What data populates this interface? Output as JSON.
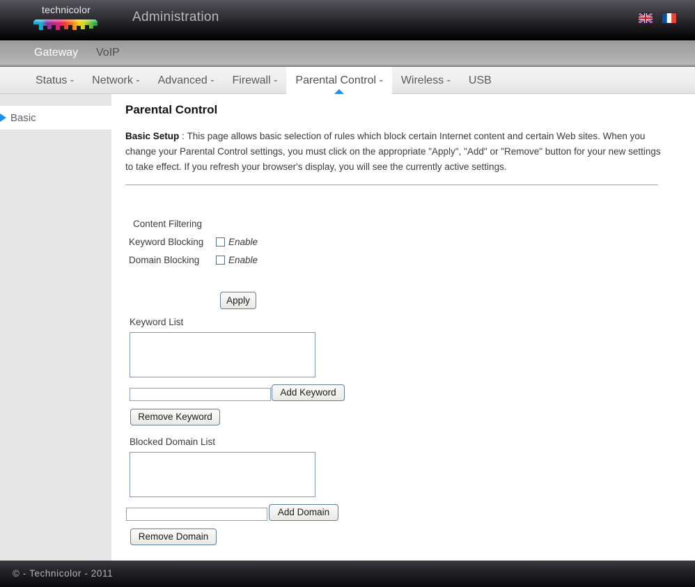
{
  "header": {
    "logo_text": "technicolor",
    "title": "Administration",
    "flags": [
      {
        "name": "flag-uk",
        "label": "English"
      },
      {
        "name": "flag-fr",
        "label": "Français"
      }
    ]
  },
  "gateway_bar": {
    "items": [
      {
        "label": "Gateway",
        "active": true
      },
      {
        "label": "VoIP",
        "active": false
      }
    ]
  },
  "nav": {
    "items": [
      {
        "label": "Status -",
        "active": false
      },
      {
        "label": "Network -",
        "active": false
      },
      {
        "label": "Advanced -",
        "active": false
      },
      {
        "label": "Firewall -",
        "active": false
      },
      {
        "label": "Parental Control -",
        "active": true
      },
      {
        "label": "Wireless -",
        "active": false
      },
      {
        "label": "USB",
        "active": false
      }
    ]
  },
  "sidebar": {
    "items": [
      {
        "label": "Basic",
        "active": true
      }
    ]
  },
  "main": {
    "page_title": "Parental Control",
    "intro_label": "Basic Setup",
    "intro_separator": " : ",
    "intro_body": "This page allows basic selection of rules which block certain Internet content and certain Web sites. When you change your Parental Control settings, you must click on the appropriate \"Apply\", \"Add\" or \"Remove\" button for your new settings to take effect. If you refresh your browser's display, you will see the currently active settings.",
    "content_filtering_title": "Content Filtering",
    "keyword_blocking_label": "Keyword Blocking",
    "keyword_blocking_enable": "Enable",
    "keyword_blocking_checked": false,
    "domain_blocking_label": "Domain Blocking",
    "domain_blocking_enable": "Enable",
    "domain_blocking_checked": false,
    "apply_button": "Apply",
    "keyword_list_label": "Keyword List",
    "keyword_list_items": [],
    "keyword_input_value": "",
    "add_keyword_button": "Add Keyword",
    "remove_keyword_button": "Remove Keyword",
    "blocked_domain_list_label": "Blocked Domain List",
    "blocked_domain_list_items": [],
    "domain_input_value": "",
    "add_domain_button": "Add Domain",
    "remove_domain_button": "Remove Domain"
  },
  "footer": {
    "text": "© - Technicolor - 2011"
  },
  "colors": {
    "accent_blue": "#1e90ec",
    "header_dark": "#000000",
    "gateway_gray": "#a6a6a6",
    "field_border": "#7e9ab5"
  }
}
